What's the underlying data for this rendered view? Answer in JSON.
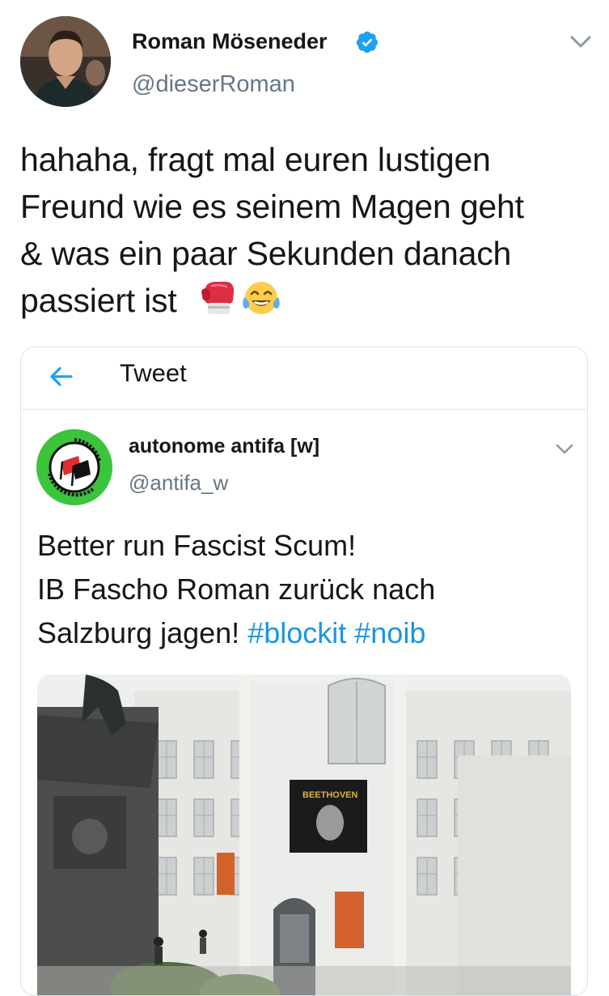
{
  "tweet": {
    "author": {
      "display_name": "Roman Möseneder",
      "handle": "@dieserRoman",
      "verified": true
    },
    "text_lines": [
      "hahaha, fragt mal euren lustigen",
      "Freund wie es seinem Magen geht",
      "& was ein paar Sekunden danach",
      "passiert ist"
    ],
    "emojis": [
      "boxing-glove-emoji",
      "tears-of-joy-emoji"
    ]
  },
  "embedded": {
    "header_title": "Tweet",
    "author": {
      "display_name": "autonome antifa [w]",
      "handle": "@antifa_w"
    },
    "text_lines": [
      "Better run Fascist Scum!",
      "IB Fascho Roman zurück nach",
      "Salzburg jagen!"
    ],
    "hashtags": [
      "#blockit",
      "#noib"
    ],
    "photo": {
      "banner_text": "BEETHOVEN",
      "icon": "building-photo"
    }
  },
  "colors": {
    "accent": "#1da1f2",
    "hashtag": "#1b95e0",
    "secondary_text": "#657786",
    "antifa_green": "#3cc43c"
  }
}
